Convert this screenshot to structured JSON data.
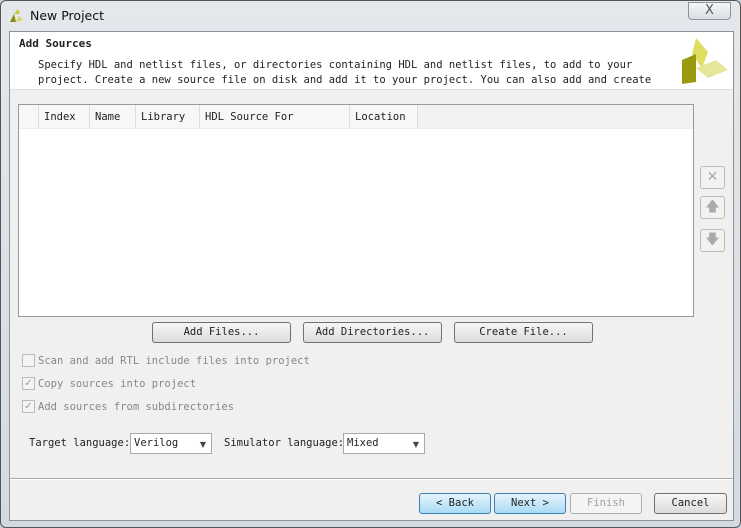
{
  "window": {
    "title": "New Project",
    "close_glyph": "X"
  },
  "header": {
    "title": "Add Sources",
    "description": "Specify HDL and netlist files, or directories containing HDL and netlist files, to add to your\nproject. Create a new source file on disk and add it to your project. You can also add and create"
  },
  "table": {
    "columns": [
      "Index",
      "Name",
      "Library",
      "HDL Source For",
      "Location"
    ],
    "rows": []
  },
  "side_buttons": [
    {
      "icon": "remove-icon",
      "glyph": "✕"
    },
    {
      "icon": "move-up-icon",
      "glyph": "🡅"
    },
    {
      "icon": "move-down-icon",
      "glyph": "🡇"
    }
  ],
  "actions": {
    "add_files": "Add Files...",
    "add_directories": "Add Directories...",
    "create_file": "Create File..."
  },
  "options": [
    {
      "label": "Scan and add RTL include files into project",
      "checked": false
    },
    {
      "label": "Copy sources into project",
      "checked": true
    },
    {
      "label": "Add sources from subdirectories",
      "checked": true
    }
  ],
  "languages": {
    "target_label": "Target language:",
    "target_value": "Verilog",
    "simulator_label": "Simulator language:",
    "simulator_value": "Mixed"
  },
  "footer": {
    "back": "< Back",
    "next": "Next >",
    "finish": "Finish",
    "cancel": "Cancel"
  }
}
